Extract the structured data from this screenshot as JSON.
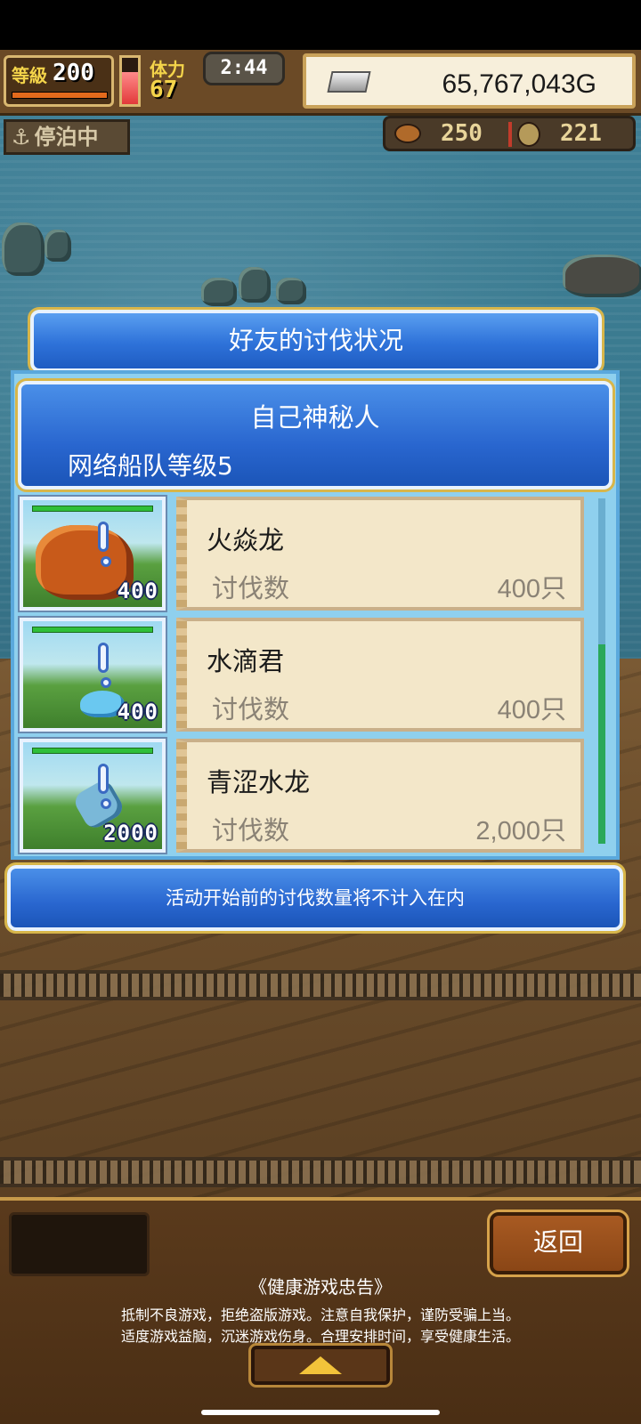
{
  "hud": {
    "level_label": "等級",
    "level_value": "200",
    "stamina_label": "体力",
    "stamina_value": "67",
    "stamina_fill_percent": 70,
    "clock": "2:44",
    "gold": "65,767,043G",
    "anchor_status": "停泊中",
    "food": "250",
    "coins": "221"
  },
  "dialog": {
    "title": "好友的讨伐状况",
    "player_name": "自己神秘人",
    "fleet_level": "网络船队等级5",
    "kill_label": "讨伐数",
    "entries": [
      {
        "name": "火焱龙",
        "badge": "400",
        "kills": "400只",
        "icon": "fire-dragon-icon"
      },
      {
        "name": "水滴君",
        "badge": "400",
        "kills": "400只",
        "icon": "water-drop-icon"
      },
      {
        "name": "青涩水龙",
        "badge": "2000",
        "kills": "2,000只",
        "icon": "water-dragon-icon"
      }
    ],
    "notice": "活动开始前的讨伐数量将不计入在内"
  },
  "bottom": {
    "back_label": "返回",
    "health_title": "《健康游戏忠告》",
    "health_line1": "抵制不良游戏，拒绝盗版游戏。注意自我保护，谨防受骗上当。",
    "health_line2": "适度游戏益脑，沉迷游戏伤身。合理安排时间，享受健康生活。"
  },
  "colors": {
    "panel_blue": "#2e72d9",
    "card_bg": "#f3e7c9",
    "gold_trim": "#d8b64a",
    "back_button": "#a85a22"
  }
}
